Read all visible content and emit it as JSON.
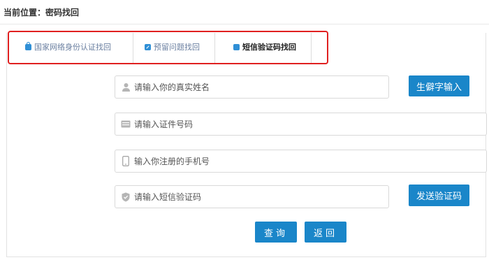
{
  "breadcrumb": {
    "text": "当前位置：密码找回"
  },
  "tabs": [
    {
      "label": "国家网络身份认证找回",
      "icon": "lock-icon",
      "active": false
    },
    {
      "label": "预留问题找回",
      "icon": "edit-icon",
      "active": false
    },
    {
      "label": "短信验证码找回",
      "icon": "phone-icon",
      "active": true
    }
  ],
  "form": {
    "name_placeholder": "请输入你的真实姓名",
    "id_placeholder": "请输入证件号码",
    "phone_placeholder": "输入你注册的手机号",
    "code_placeholder": "请输入短信验证码"
  },
  "buttons": {
    "rare_char": "生僻字输入",
    "send_code": "发送验证码",
    "query": "查询",
    "back": "返回"
  },
  "colors": {
    "accent": "#1a86c9",
    "tab_inactive": "#6a7fa0",
    "highlight_border": "#e02020"
  }
}
